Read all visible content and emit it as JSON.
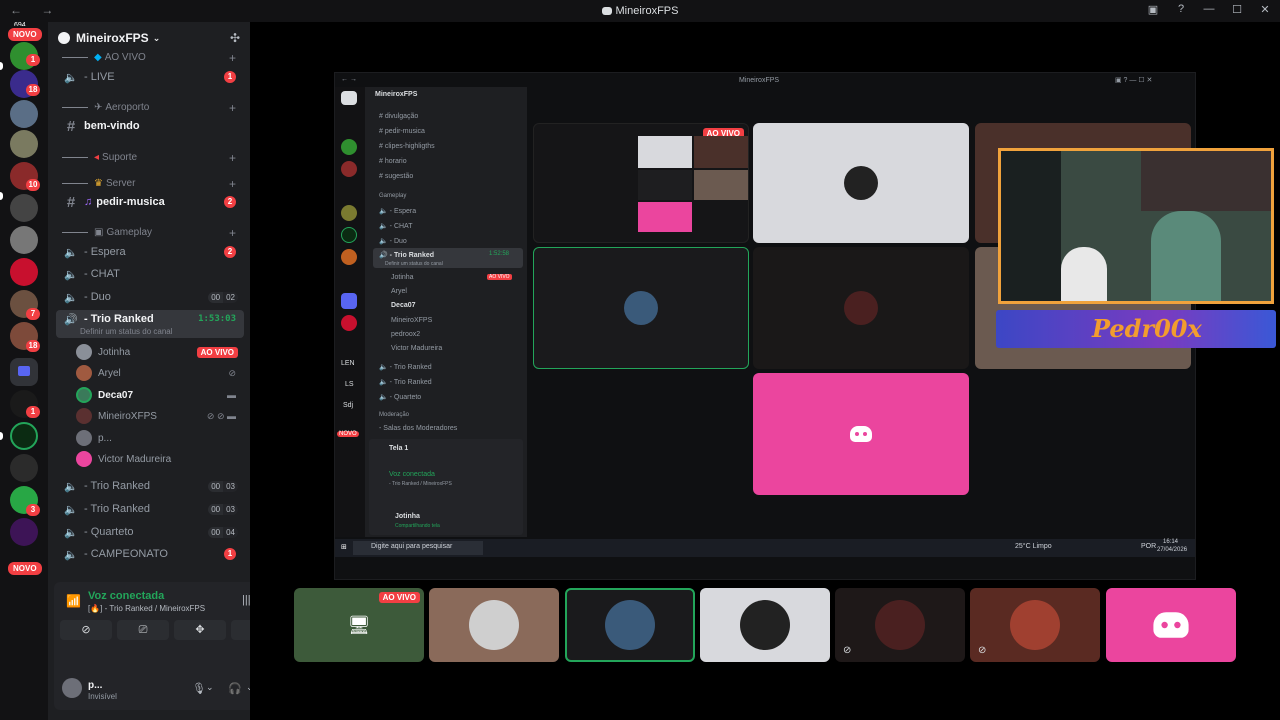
{
  "window": {
    "title": "MineiroxFPS",
    "nav": "← →",
    "controls": [
      "▣",
      "?",
      "—",
      "☐",
      "✕"
    ]
  },
  "rail": {
    "top_count": "694",
    "badges": [
      "1",
      "18",
      "10",
      "7",
      "18",
      "1",
      "3"
    ],
    "novo_top": "NOVO",
    "novo_bottom": "NOVO"
  },
  "guild": {
    "name": "MineiroxFPS",
    "chevron": "⌄"
  },
  "categories": {
    "ao_vivo": "AO VIVO",
    "aeroporto": "Aeroporto",
    "suporte": "Suporte",
    "server": "Server",
    "gameplay": "Gameplay"
  },
  "channels": {
    "live": "- LIVE",
    "live_badge": "1",
    "bem_vindo": "bem-vindo",
    "pedir_musica": "pedir-musica",
    "pedir_musica_badge": "2",
    "espera": "- Espera",
    "espera_badge": "2",
    "chat": "- CHAT",
    "duo": "- Duo",
    "duo_counts": [
      "00",
      "02"
    ],
    "trio_ranked": "- Trio Ranked",
    "trio_timer": "1:53:03",
    "trio_status": "Definir um status do canal",
    "trio2": "- Trio Ranked",
    "trio2_counts": [
      "00",
      "03"
    ],
    "trio3": "- Trio Ranked",
    "trio3_counts": [
      "00",
      "03"
    ],
    "quarteto": "- Quarteto",
    "quarteto_counts": [
      "00",
      "04"
    ],
    "campeonato": "- CAMPEONATO",
    "campeonato_badge": "1"
  },
  "members": [
    {
      "name": "Jotinha",
      "live": "AO VIVO"
    },
    {
      "name": "Aryel"
    },
    {
      "name": "Deca07"
    },
    {
      "name": "MineiroXFPS"
    },
    {
      "name": "p..."
    },
    {
      "name": "Victor Madureira"
    }
  ],
  "voice": {
    "title": "Voz conectada",
    "subtitle": "[🔥] - Trio Ranked / MineiroxFPS"
  },
  "user": {
    "name": "p...",
    "status": "Invisível"
  },
  "stream": {
    "title": "MineiroxFPS",
    "guild": "MineiroxFPS",
    "channels": [
      "divulgação",
      "pedir-musica",
      "clipes-highligths",
      "horario",
      "sugestão"
    ],
    "category_gameplay": "Gameplay",
    "voice_channels": [
      "- Espera",
      "- CHAT",
      "- Duo",
      "- Trio Ranked"
    ],
    "timer": "1:52:58",
    "status": "Definir um status do canal",
    "members": [
      "Jotinha",
      "Aryel",
      "Deca07",
      "MineiroXFPS",
      "pedroox2",
      "Victor Madureira"
    ],
    "more_channels": [
      "- Trio Ranked",
      "- Trio Ranked",
      "- Quarteto"
    ],
    "moderation": "Moderação",
    "mod_room": "- Salas dos Moderadores",
    "screen_label": "Tela 1",
    "voice_title": "Voz conectada",
    "voice_sub": "- Trio Ranked / MineiroxFPS",
    "user": "Jotinha",
    "user_status": "Compartilhando tela",
    "live": "AO VIVO",
    "rail_labels": [
      "LEN",
      "LS",
      "Sdj"
    ],
    "rail_novo": "NOVO",
    "taskbar_search": "Digite aqui para pesquisar",
    "weather": "25°C  Limpo",
    "lang": "POR",
    "clock_time": "16:14",
    "clock_date": "27/04/2026"
  },
  "cam_banner": "Pedr00x",
  "strip": {
    "live": "AO VIVO"
  },
  "colors": {
    "accent_green": "#23a55a",
    "live_red": "#f23f43",
    "discord_pink": "#eb459e",
    "cam_border": "#f0a23c"
  }
}
